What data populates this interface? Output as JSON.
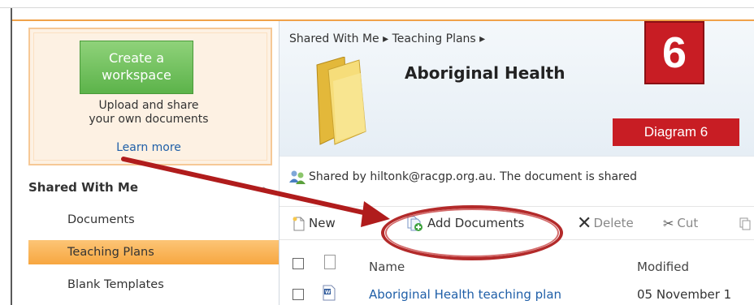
{
  "sidebar": {
    "promo": {
      "create_line1": "Create a",
      "create_line2": "workspace",
      "text_line1": "Upload and share",
      "text_line2": "your own documents",
      "learn_more": "Learn more"
    },
    "section_title": "Shared With Me",
    "items": [
      {
        "label": "Documents"
      },
      {
        "label": "Teaching Plans"
      },
      {
        "label": "Blank Templates"
      }
    ]
  },
  "main": {
    "breadcrumb": "Shared With Me ▸ Teaching Plans ▸",
    "title": "Aboriginal Health",
    "shared_info": "Shared by hiltonk@racgp.org.au. The document is shared",
    "toolbar": {
      "new": "New",
      "add_documents": "Add Documents",
      "delete": "Delete",
      "cut": "Cut"
    },
    "columns": {
      "name": "Name",
      "modified": "Modified"
    },
    "rows": [
      {
        "name": "Aboriginal Health teaching plan",
        "modified": "05 November 1"
      }
    ]
  },
  "annotation": {
    "badge_number": "6",
    "diagram_label": "Diagram 6",
    "color": "#c81d24"
  },
  "colors": {
    "accent_orange": "#f7a740",
    "create_green": "#5cb34a",
    "link_blue": "#1f5fa8"
  }
}
